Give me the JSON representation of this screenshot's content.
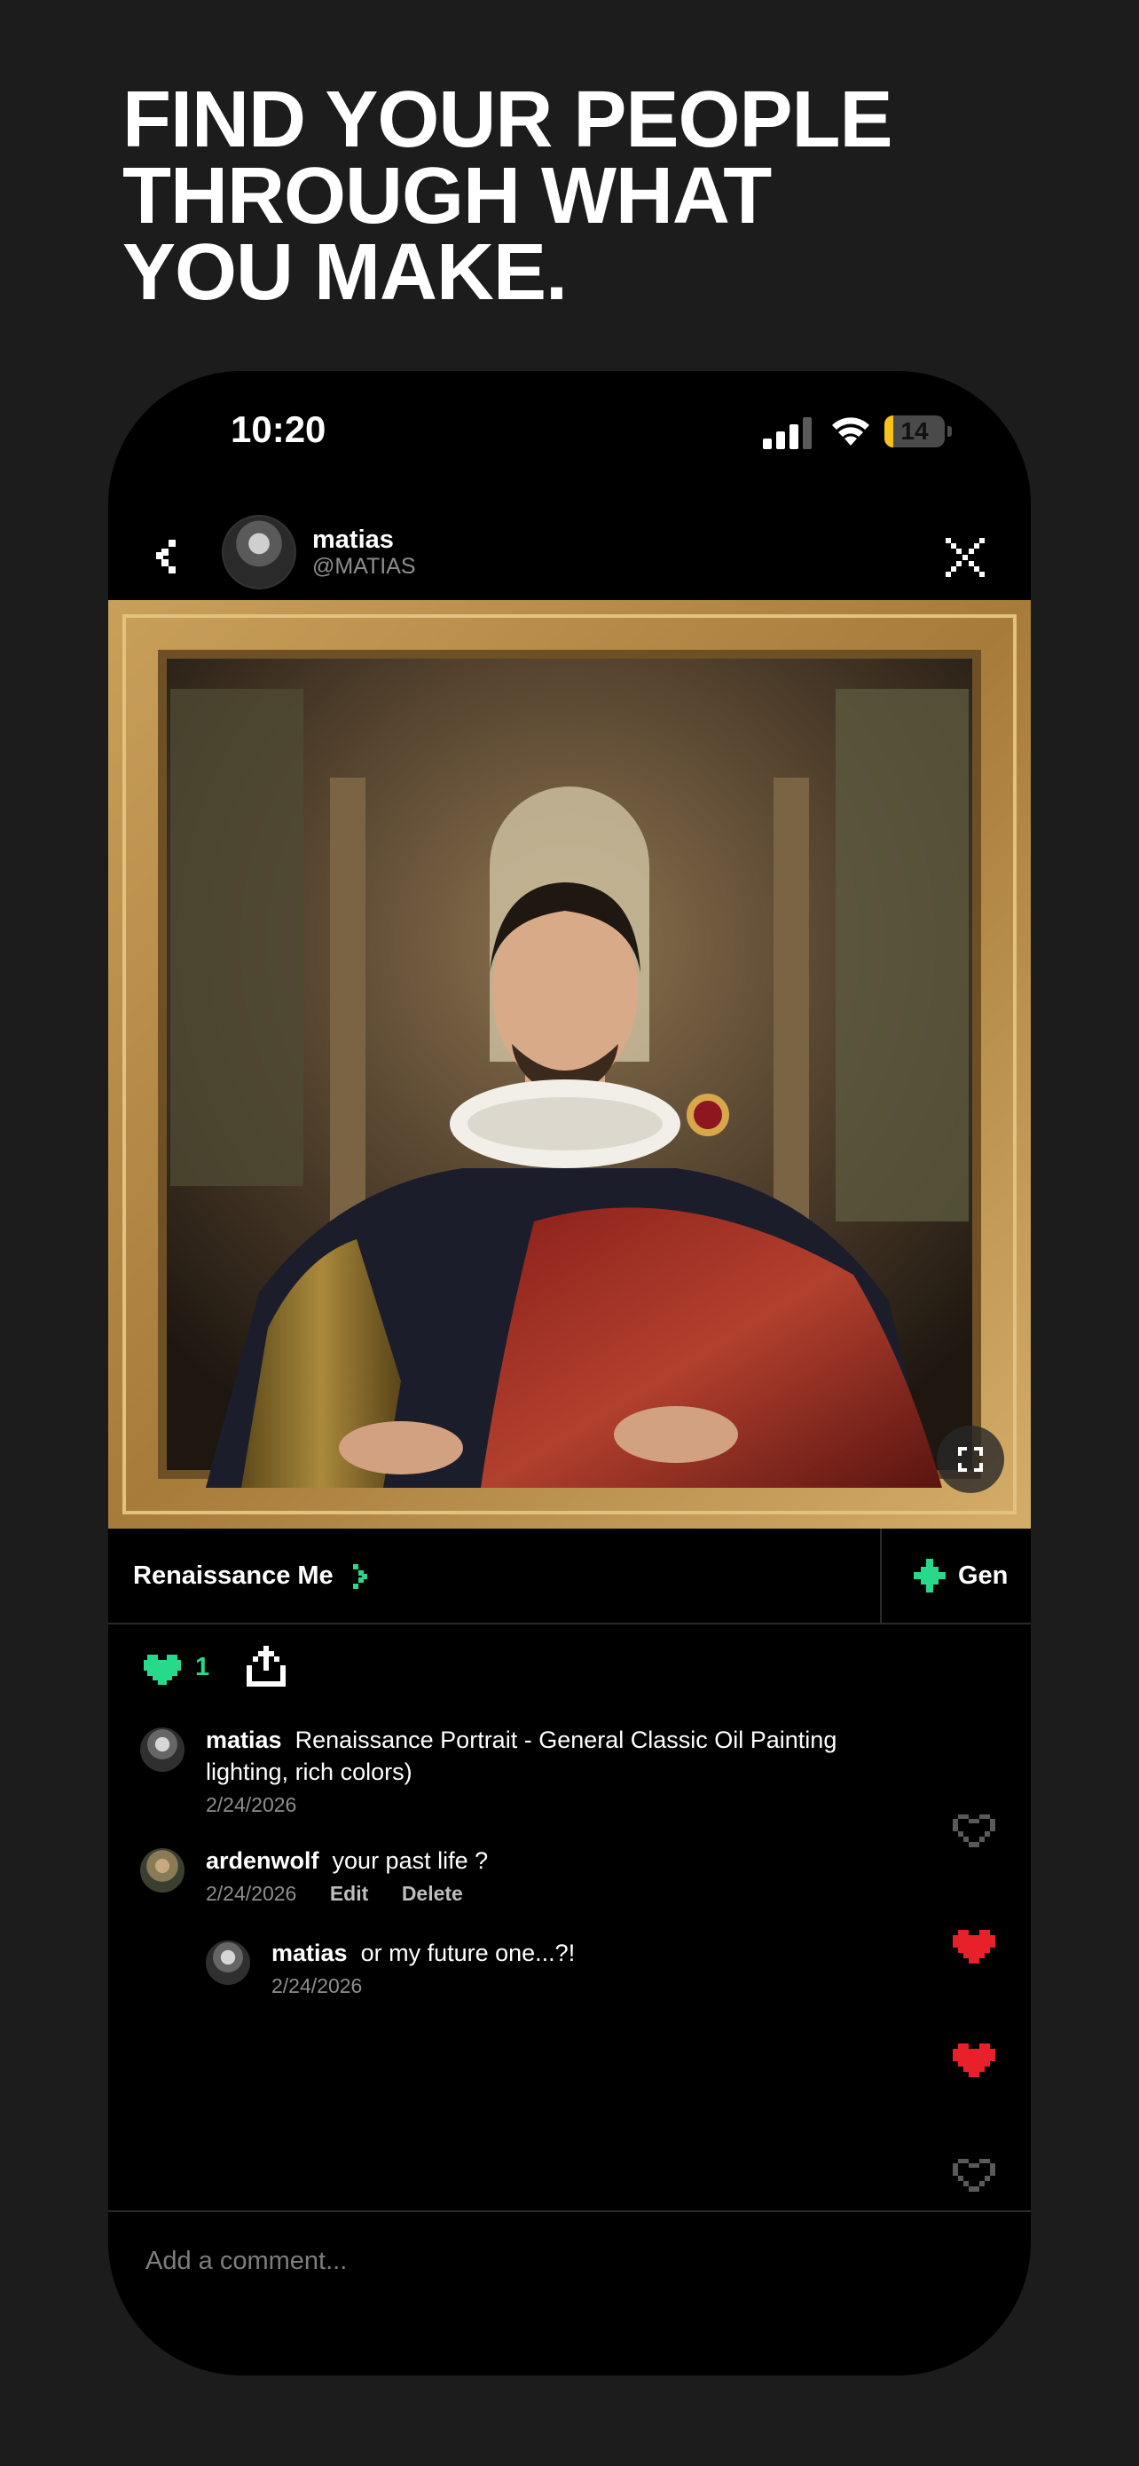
{
  "headline": {
    "line1": "FIND YOUR PEOPLE",
    "line2": "THROUGH WHAT",
    "line3": "YOU MAKE."
  },
  "status_bar": {
    "time": "10:20",
    "battery": "14",
    "battery_level": 0.14
  },
  "post_header": {
    "name": "matias",
    "handle": "@MATIAS"
  },
  "generation": {
    "style_label": "Renaissance Me",
    "gen_label": "Gen"
  },
  "actions": {
    "like_count": "1"
  },
  "comments": [
    {
      "user": "matias",
      "text": "Renaissance Portrait - General Classic Oil Painting",
      "text_cont": "lighting, rich colors)",
      "date": "2/24/2026"
    },
    {
      "user": "ardenwolf",
      "text": "your past life ?",
      "date": "2/24/2026",
      "edit_label": "Edit",
      "delete_label": "Delete"
    },
    {
      "user": "matias",
      "text": "or my future one...?!",
      "date": "2/24/2026"
    }
  ],
  "comment_input": {
    "placeholder": "Add a comment..."
  },
  "colors": {
    "accent_green": "#27d98a",
    "heart_red": "#e8202a",
    "background": "#1c1c1c"
  },
  "icons": {
    "back": "pixel-chevron-left-icon",
    "close": "pixel-x-icon",
    "expand": "expand-icon",
    "generate": "sparkle-icon",
    "like": "pixel-heart-icon",
    "share": "share-icon"
  }
}
